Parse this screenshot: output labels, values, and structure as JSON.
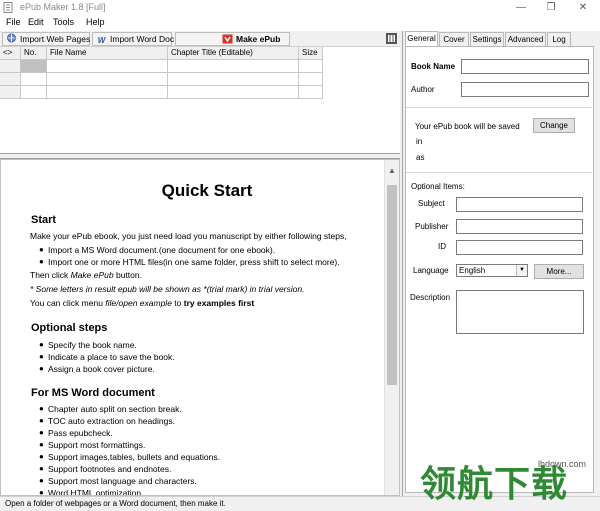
{
  "window": {
    "title": "ePub Maker 1.8 [Full]",
    "minimize_glyph": "—",
    "restore_glyph": "❐",
    "close_glyph": "✕"
  },
  "menu": [
    "File",
    "Edit",
    "Tools",
    "Help"
  ],
  "toolbar": {
    "import_web_pages": "Import Web Pages",
    "import_word_doc": "Import Word Doc",
    "make_epub": "Make ePub",
    "word_icon_glyph": "W"
  },
  "grid": {
    "columns": [
      "<>",
      "No.",
      "File Name",
      "Chapter Title (Editable)",
      "Size"
    ]
  },
  "quick_start": {
    "title": "Quick Start",
    "start_heading": "Start",
    "start_intro": "Make your ePub ebook, you just need load you manuscript by either following steps,",
    "start_items": [
      "Import a MS Word document.(one document for one ebook).",
      "Import one or more HTML files(in one same folder, press shift to select more)."
    ],
    "then_click_prefix": "Then click ",
    "then_click_em": "Make ePub",
    "then_click_suffix": " button.",
    "trial_note": "* Some letters in result epub will be shown as *(trial mark) in trial version.",
    "examples_prefix": "You can click menu ",
    "examples_em": "file/open example",
    "examples_mid": " to ",
    "examples_strong": "try examples first",
    "optional_heading": "Optional steps",
    "optional_items": [
      "Specify the book name.",
      "Indicate a place to save the book.",
      "Assign a book cover picture."
    ],
    "word_heading": "For MS Word document",
    "word_items": [
      "Chapter auto split on section break.",
      "TOC auto extraction on headings.",
      "Pass epubcheck.",
      "Support most formattings.",
      "Support images,tables, bullets and equations.",
      "Support footnotes and endnotes.",
      "Support most language and characters.",
      "Word HTML optimization"
    ]
  },
  "status_bar": "Open a folder of webpages or a Word document, then make it.",
  "right_panel": {
    "tabs": [
      "General",
      "Cover",
      "Settings",
      "Advanced",
      "Log"
    ],
    "active_tab": "General",
    "book_name_label": "Book Name",
    "author_label": "Author",
    "saved_text": "Your ePub book will be saved",
    "change_button": "Change",
    "in_label": "in",
    "as_label": "as",
    "optional_items_label": "Optional Items:",
    "subject_label": "Subject",
    "publisher_label": "Publisher",
    "id_label": "ID",
    "language_label": "Language",
    "language_value": "English",
    "more_button": "More...",
    "description_label": "Description"
  },
  "watermark": {
    "text": "领航下载",
    "url": "lhdown.com"
  },
  "colors": {
    "make_epub_icon": "#d9322a",
    "word_icon": "#2b5797",
    "selected_cell": "#c0c0c0",
    "watermark": "#2f8a33"
  }
}
